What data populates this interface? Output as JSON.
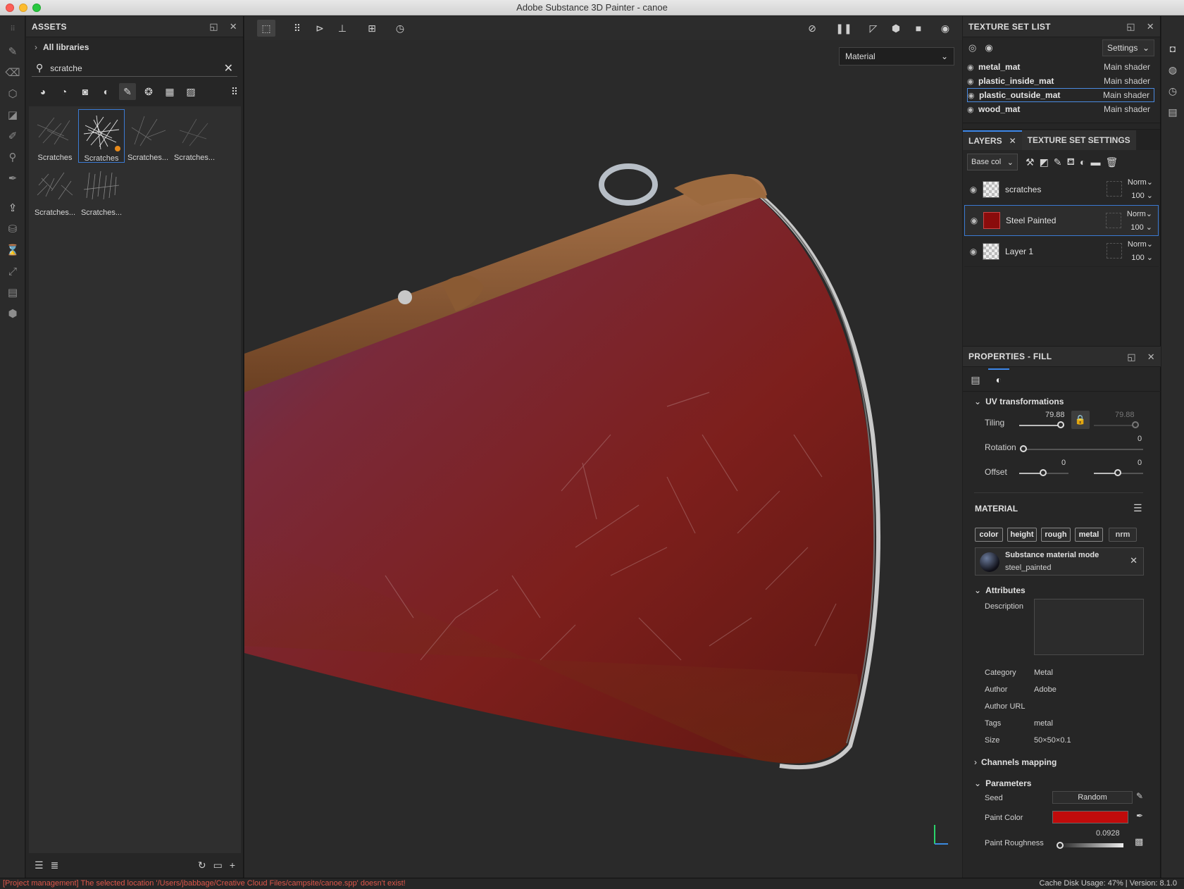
{
  "window": {
    "title": "Adobe Substance 3D Painter - canoe"
  },
  "assets": {
    "title": "ASSETS",
    "libraries_label": "All libraries",
    "search_value": "scratche",
    "items": [
      {
        "label": "Scratches"
      },
      {
        "label": "Scratches"
      },
      {
        "label": "Scratches..."
      },
      {
        "label": "Scratches..."
      },
      {
        "label": "Scratches..."
      },
      {
        "label": "Scratches..."
      }
    ]
  },
  "viewport": {
    "view_mode": "Material"
  },
  "texture_set_list": {
    "title": "TEXTURE SET LIST",
    "settings_label": "Settings",
    "rows": [
      {
        "name": "metal_mat",
        "shader": "Main shader"
      },
      {
        "name": "plastic_inside_mat",
        "shader": "Main shader"
      },
      {
        "name": "plastic_outside_mat",
        "shader": "Main shader"
      },
      {
        "name": "wood_mat",
        "shader": "Main shader"
      }
    ]
  },
  "layers": {
    "tab_layers": "LAYERS",
    "tab_settings": "TEXTURE SET SETTINGS",
    "channel": "Base col",
    "rows": [
      {
        "name": "scratches",
        "blend": "Norm",
        "opacity": "100"
      },
      {
        "name": "Steel Painted",
        "blend": "Norm",
        "opacity": "100"
      },
      {
        "name": "Layer 1",
        "blend": "Norm",
        "opacity": "100"
      }
    ]
  },
  "properties": {
    "title": "PROPERTIES - FILL",
    "uv_title": "UV transformations",
    "tiling_label": "Tiling",
    "tiling_value": "79.88",
    "tiling_value2": "79.88",
    "rotation_label": "Rotation",
    "rotation_value": "0",
    "offset_label": "Offset",
    "offset_value1": "0",
    "offset_value2": "0",
    "material_title": "MATERIAL",
    "chips": [
      "color",
      "height",
      "rough",
      "metal",
      "nrm"
    ],
    "material_mode_title": "Substance material mode",
    "material_name": "steel_painted",
    "attributes_title": "Attributes",
    "description_label": "Description",
    "category_label": "Category",
    "category_value": "Metal",
    "author_label": "Author",
    "author_value": "Adobe",
    "author_url_label": "Author URL",
    "tags_label": "Tags",
    "tags_value": "metal",
    "size_label": "Size",
    "size_value": "50×50×0.1",
    "channels_mapping_title": "Channels mapping",
    "parameters_title": "Parameters",
    "seed_label": "Seed",
    "seed_value": "Random",
    "paint_color_label": "Paint Color",
    "paint_color": "#c00b0b",
    "paint_roughness_label": "Paint Roughness",
    "paint_roughness_value": "0.0928"
  },
  "status": {
    "message": "[Project management] The selected location '/Users/jbabbage/Creative Cloud Files/campsite/canoe.spp' doesn't exist!",
    "right": "Cache Disk Usage:     47% | Version: 8.1.0"
  }
}
